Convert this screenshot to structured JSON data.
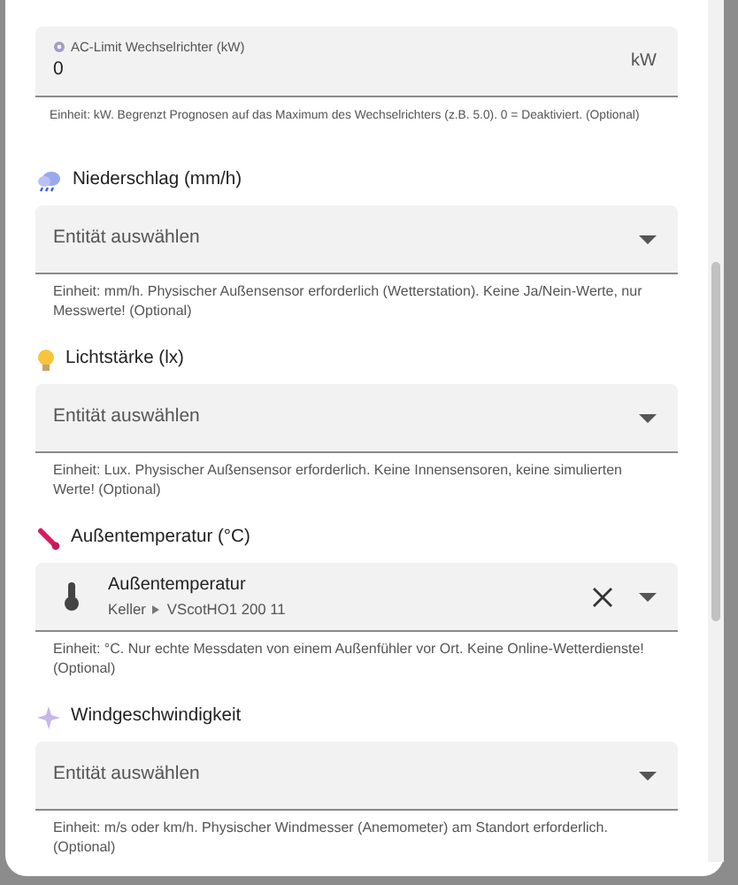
{
  "ac_limit": {
    "label": "AC-Limit Wechselrichter (kW)",
    "value": "0",
    "suffix": "kW",
    "helper": "Einheit: kW. Begrenzt Prognosen auf das Maximum des Wechselrichters (z.B. 5.0). 0 = Deaktiviert. (Optional)"
  },
  "sensors": [
    {
      "heading": "Niederschlag (mm/h)",
      "field": {
        "kind": "empty",
        "placeholder": "Entität auswählen"
      },
      "helper": "Einheit: mm/h. Physischer Außensensor erforderlich (Wetterstation). Keine Ja/Nein-Werte, nur Messwerte! (Optional)"
    },
    {
      "heading": "Lichtstärke (lx)",
      "field": {
        "kind": "empty",
        "placeholder": "Entität auswählen"
      },
      "helper": "Einheit: Lux. Physischer Außensensor erforderlich. Keine Innensensoren, keine simulierten Werte! (Optional)"
    },
    {
      "heading": "Außentemperatur (°C)",
      "field": {
        "kind": "selected",
        "name": "Außentemperatur",
        "area": "Keller",
        "device": "VScotHO1 200 11"
      },
      "helper": "Einheit: °C. Nur echte Messdaten von einem Außenfühler vor Ort. Keine Online-Wetterdienste! (Optional)"
    },
    {
      "heading": "Windgeschwindigkeit",
      "field": {
        "kind": "empty",
        "placeholder": "Entität auswählen"
      },
      "helper": "Einheit: m/s oder km/h. Physischer Windmesser (Anemometer) am Standort erforderlich. (Optional)"
    }
  ]
}
